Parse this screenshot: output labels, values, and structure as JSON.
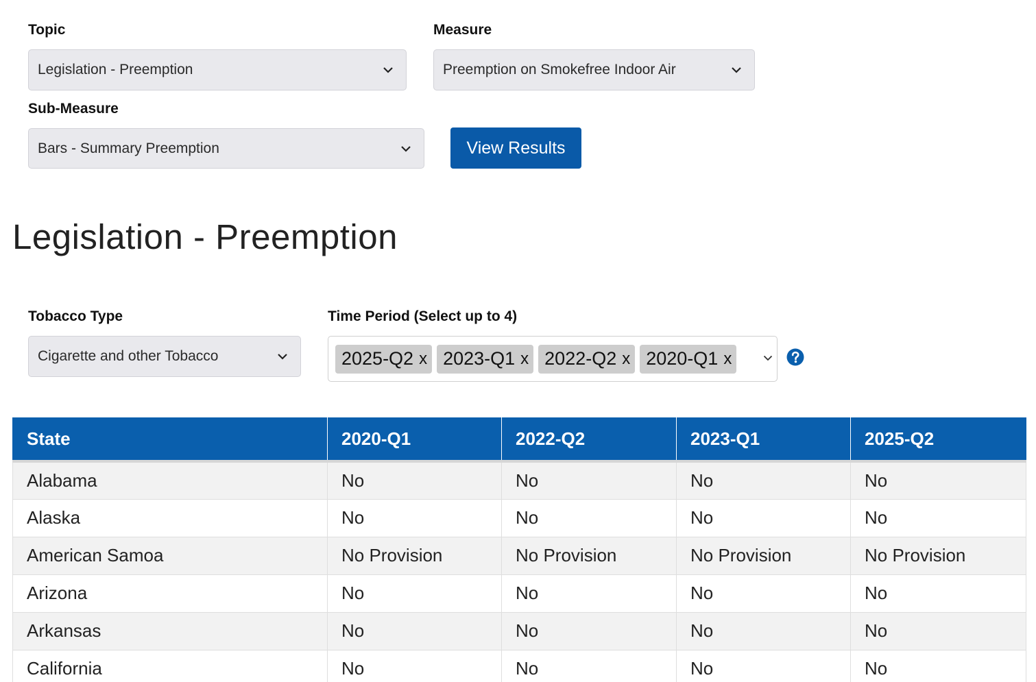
{
  "filters": {
    "topic": {
      "label": "Topic",
      "value": "Legislation - Preemption"
    },
    "measure": {
      "label": "Measure",
      "value": "Preemption on Smokefree Indoor Air"
    },
    "sub_measure": {
      "label": "Sub-Measure",
      "value": "Bars - Summary Preemption"
    },
    "view_results_label": "View Results"
  },
  "page_title": "Legislation - Preemption",
  "tobacco_type": {
    "label": "Tobacco Type",
    "value": "Cigarette and other Tobacco"
  },
  "time_period": {
    "label": "Time Period (Select up to 4)",
    "selected": [
      {
        "value": "2025-Q2",
        "remove": "x"
      },
      {
        "value": "2023-Q1",
        "remove": "x"
      },
      {
        "value": "2022-Q2",
        "remove": "x"
      },
      {
        "value": "2020-Q1",
        "remove": "x"
      }
    ]
  },
  "table": {
    "columns": [
      "State",
      "2020-Q1",
      "2022-Q2",
      "2023-Q1",
      "2025-Q2"
    ],
    "rows": [
      [
        "Alabama",
        "No",
        "No",
        "No",
        "No"
      ],
      [
        "Alaska",
        "No",
        "No",
        "No",
        "No"
      ],
      [
        "American Samoa",
        "No Provision",
        "No Provision",
        "No Provision",
        "No Provision"
      ],
      [
        "Arizona",
        "No",
        "No",
        "No",
        "No"
      ],
      [
        "Arkansas",
        "No",
        "No",
        "No",
        "No"
      ],
      [
        "California",
        "No",
        "No",
        "No",
        "No"
      ]
    ]
  },
  "colors": {
    "primary": "#0a5fad",
    "select_bg": "#e9e9ed",
    "chip_bg": "#cdcdcd",
    "row_alt": "#f2f2f2"
  }
}
